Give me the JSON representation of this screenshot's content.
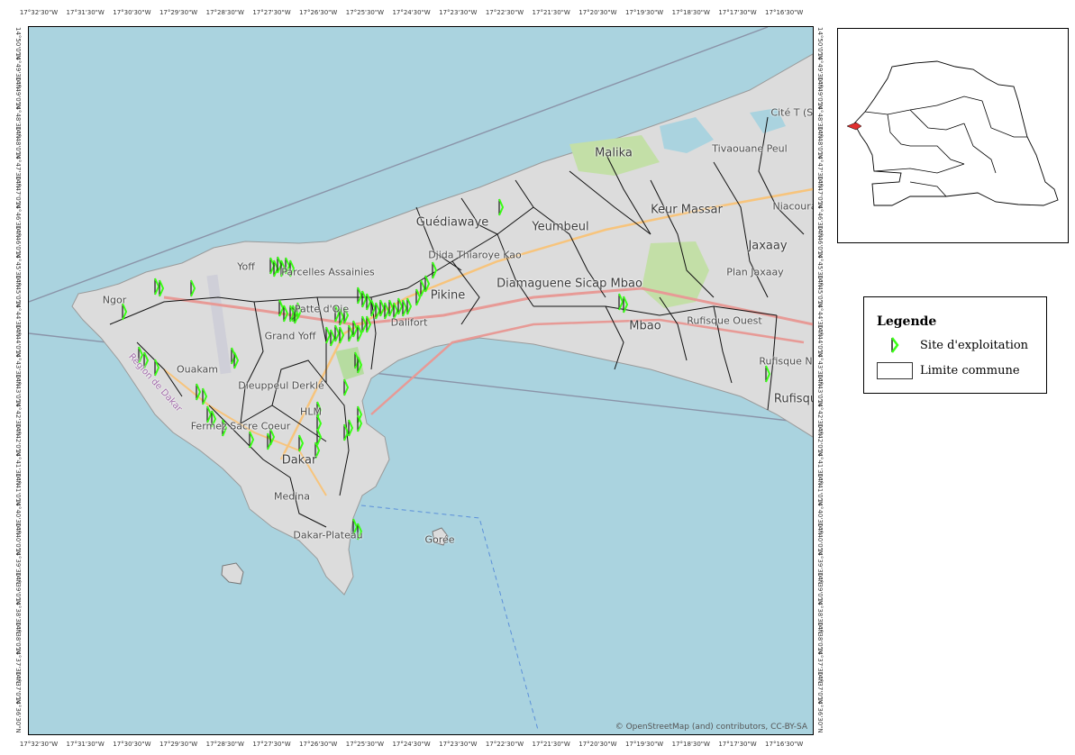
{
  "map": {
    "attribution": "© OpenStreetMap (and) contributors, CC-BY-SA",
    "colors": {
      "sea": "#aad3df",
      "land": "#dedede",
      "commune_border": "#111111",
      "site_symbol": "#39ff14"
    },
    "axis_labels": {
      "top": [
        "17°32'30\"W",
        "17°31'30\"W",
        "17°30'30\"W",
        "17°29'30\"W",
        "17°28'30\"W",
        "17°27'30\"W",
        "17°26'30\"W",
        "17°25'30\"W",
        "17°24'30\"W",
        "17°23'30\"W",
        "17°22'30\"W",
        "17°21'30\"W",
        "17°20'30\"W",
        "17°19'30\"W",
        "17°18'30\"W",
        "17°17'30\"W",
        "17°16'30\"W"
      ],
      "bottom": [
        "17°32'30\"W",
        "17°31'30\"W",
        "17°30'30\"W",
        "17°29'30\"W",
        "17°28'30\"W",
        "17°27'30\"W",
        "17°26'30\"W",
        "17°25'30\"W",
        "17°24'30\"W",
        "17°23'30\"W",
        "17°22'30\"W",
        "17°21'30\"W",
        "17°20'30\"W",
        "17°19'30\"W",
        "17°18'30\"W",
        "17°17'30\"W",
        "17°16'30\"W"
      ],
      "left": [
        "14°50'0\"N",
        "14°49'30\"N",
        "14°49'0\"N",
        "14°48'30\"N",
        "14°48'0\"N",
        "14°47'30\"N",
        "14°47'0\"N",
        "14°46'30\"N",
        "14°46'0\"N",
        "14°45'30\"N",
        "14°45'0\"N",
        "14°44'30\"N",
        "14°44'0\"N",
        "14°43'30\"N",
        "14°43'0\"N",
        "14°42'30\"N",
        "14°42'0\"N",
        "14°41'30\"N",
        "14°41'0\"N",
        "14°40'30\"N",
        "14°40'0\"N",
        "14°39'30\"N",
        "14°39'0\"N",
        "14°38'30\"N",
        "14°38'0\"N",
        "14°37'30\"N",
        "14°37'0\"N",
        "14°36'30\"N"
      ],
      "right": [
        "14°50'0\"N",
        "14°49'30\"N",
        "14°49'0\"N",
        "14°48'30\"N",
        "14°48'0\"N",
        "14°47'30\"N",
        "14°47'0\"N",
        "14°46'30\"N",
        "14°46'0\"N",
        "14°45'30\"N",
        "14°45'0\"N",
        "14°44'30\"N",
        "14°44'0\"N",
        "14°43'30\"N",
        "14°43'0\"N",
        "14°42'30\"N",
        "14°42'0\"N",
        "14°41'30\"N",
        "14°41'0\"N",
        "14°40'30\"N",
        "14°40'0\"N",
        "14°39'30\"N",
        "14°39'0\"N",
        "14°38'30\"N",
        "14°38'0\"N",
        "14°37'30\"N",
        "14°37'0\"N",
        "14°36'30\"N"
      ]
    },
    "places": [
      "Malika",
      "Tivaouane Peul",
      "Cité T (SOC",
      "Guédiawaye",
      "Yeumbeul",
      "Keur Massar",
      "Niacoura",
      "Jaxaay",
      "Djida Thiaroye Kao",
      "Yoff",
      "Parcelles Assainies",
      "Diamaguene Sicap Mbao",
      "Plan Jaxaay",
      "Ngor",
      "Patte d'Oie",
      "Pikine",
      "Dalifort",
      "Mbao",
      "Rufisque Ouest",
      "Grand Yoff",
      "Rufisque N",
      "Ouakam",
      "Dieuppeul Derklé",
      "Rufisque",
      "HLM",
      "Fermez Sacre Coeur",
      "Dakar",
      "Medina",
      "Dakar-Plateau",
      "Gorée",
      "Région de Dakar"
    ]
  },
  "legend": {
    "title": "Legende",
    "items": [
      {
        "label": "Site d'exploitation"
      },
      {
        "label": "Limite commune"
      }
    ]
  }
}
